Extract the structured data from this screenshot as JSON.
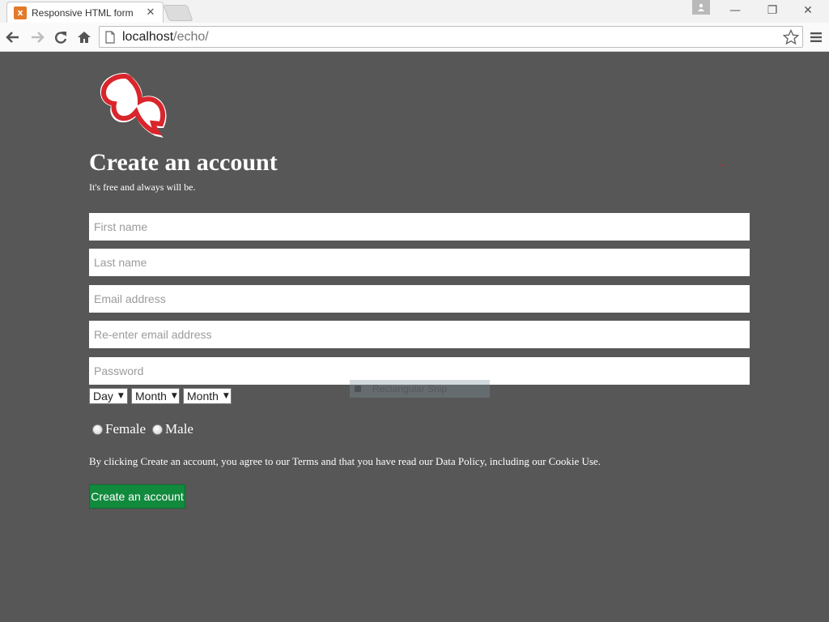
{
  "browser": {
    "tab": {
      "favicon": "x",
      "title": "Responsive HTML form",
      "close": "✕"
    },
    "url": {
      "host": "localhost",
      "path": "/echo/"
    },
    "window_controls": {
      "minimize": "—",
      "maximize": "❐",
      "close": "✕"
    },
    "icons": {
      "back": "back-arrow-icon",
      "forward": "forward-arrow-icon",
      "reload": "reload-icon",
      "home": "home-icon",
      "page": "page-icon",
      "bookmark": "star-icon",
      "menu": "hamburger-menu-icon",
      "profile": "user-icon"
    }
  },
  "page": {
    "heading": "Create an account",
    "subheading": "It's free and always will be.",
    "fields": {
      "first_name": "First name",
      "last_name": "Last name",
      "email": "Email address",
      "email_confirm": "Re-enter email address",
      "password": "Password"
    },
    "birthday": {
      "day": "Day",
      "month1": "Month",
      "month2": "Month",
      "arrow": "▼"
    },
    "gender": {
      "female": "Female",
      "male": "Male"
    },
    "terms": "By clicking Create an account, you agree to our Terms and that you have read our Data Policy, including our Cookie Use.",
    "submit": "Create an account",
    "overlay_label": "Rectangular Snip"
  },
  "colors": {
    "page_background": "#565756",
    "logo_red": "#d9252c",
    "button_green": "#128a3e",
    "text": "#ffffff"
  }
}
